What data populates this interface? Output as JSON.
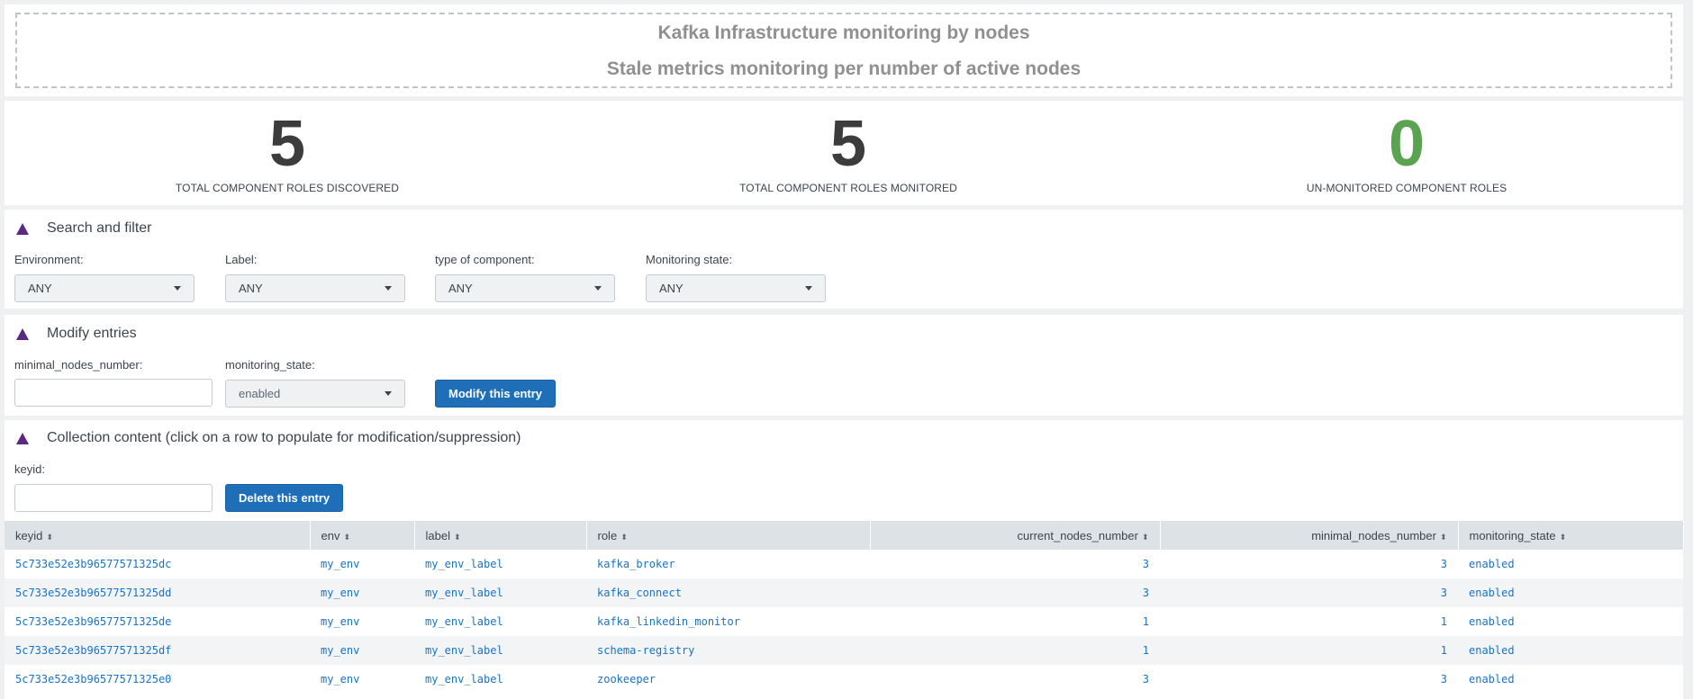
{
  "header": {
    "line1": "Kafka Infrastructure monitoring by nodes",
    "line2": "Stale metrics monitoring per number of active nodes"
  },
  "singles": [
    {
      "value": "5",
      "label": "TOTAL COMPONENT ROLES DISCOVERED",
      "color": "#3c3c3c"
    },
    {
      "value": "5",
      "label": "TOTAL COMPONENT ROLES MONITORED",
      "color": "#3c3c3c"
    },
    {
      "value": "0",
      "label": "UN-MONITORED COMPONENT ROLES",
      "color": "#5aa351"
    }
  ],
  "filter": {
    "title": "Search and filter",
    "fields": [
      {
        "label": "Environment:",
        "value": "ANY"
      },
      {
        "label": "Label:",
        "value": "ANY"
      },
      {
        "label": "type of component:",
        "value": "ANY"
      },
      {
        "label": "Monitoring state:",
        "value": "ANY"
      }
    ]
  },
  "modify": {
    "title": "Modify entries",
    "min_nodes_label": "minimal_nodes_number:",
    "min_nodes_value": "",
    "state_label": "monitoring_state:",
    "state_value": "enabled",
    "button": "Modify this entry"
  },
  "collection": {
    "title": "Collection content (click on a row to populate for modification/suppression)",
    "keyid_label": "keyid:",
    "keyid_value": "",
    "delete_button": "Delete this entry",
    "columns": [
      "keyid",
      "env",
      "label",
      "role",
      "current_nodes_number",
      "minimal_nodes_number",
      "monitoring_state"
    ],
    "rows": [
      [
        "5c733e52e3b96577571325dc",
        "my_env",
        "my_env_label",
        "kafka_broker",
        "3",
        "3",
        "enabled"
      ],
      [
        "5c733e52e3b96577571325dd",
        "my_env",
        "my_env_label",
        "kafka_connect",
        "3",
        "3",
        "enabled"
      ],
      [
        "5c733e52e3b96577571325de",
        "my_env",
        "my_env_label",
        "kafka_linkedin_monitor",
        "1",
        "1",
        "enabled"
      ],
      [
        "5c733e52e3b96577571325df",
        "my_env",
        "my_env_label",
        "schema-registry",
        "1",
        "1",
        "enabled"
      ],
      [
        "5c733e52e3b96577571325e0",
        "my_env",
        "my_env_label",
        "zookeeper",
        "3",
        "3",
        "enabled"
      ]
    ]
  }
}
